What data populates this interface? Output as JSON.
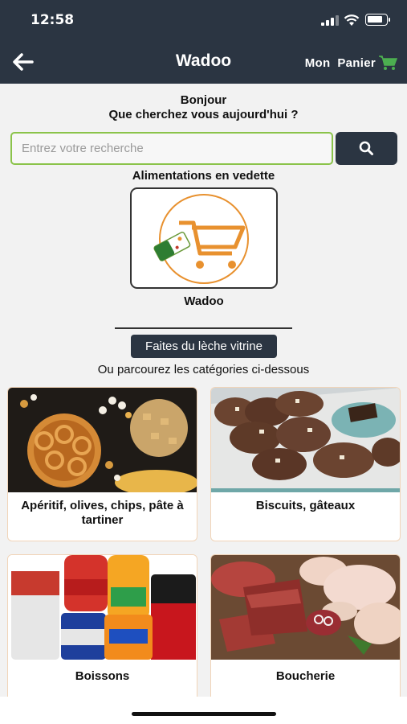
{
  "status": {
    "time": "12:58"
  },
  "header": {
    "title": "Wadoo",
    "cart_label": "Mon  Panier"
  },
  "greeting": {
    "line1": "Bonjour",
    "line2": "Que cherchez vous aujourd'hui ?"
  },
  "search": {
    "placeholder": "Entrez votre recherche",
    "value": ""
  },
  "featured": {
    "heading": "Alimentations en vedette",
    "name": "Wadoo"
  },
  "vitrine_button": "Faites du lèche vitrine",
  "categories_intro": "Ou parcourez les catégories ci-dessous",
  "categories": [
    {
      "label": "Apéritif, olives, chips, pâte à tartiner"
    },
    {
      "label": "Biscuits, gâteaux"
    },
    {
      "label": "Boissons"
    },
    {
      "label": "Boucherie"
    }
  ],
  "colors": {
    "dark": "#2b3542",
    "accent_green": "#8bc34a",
    "logo_orange": "#e8912f"
  }
}
